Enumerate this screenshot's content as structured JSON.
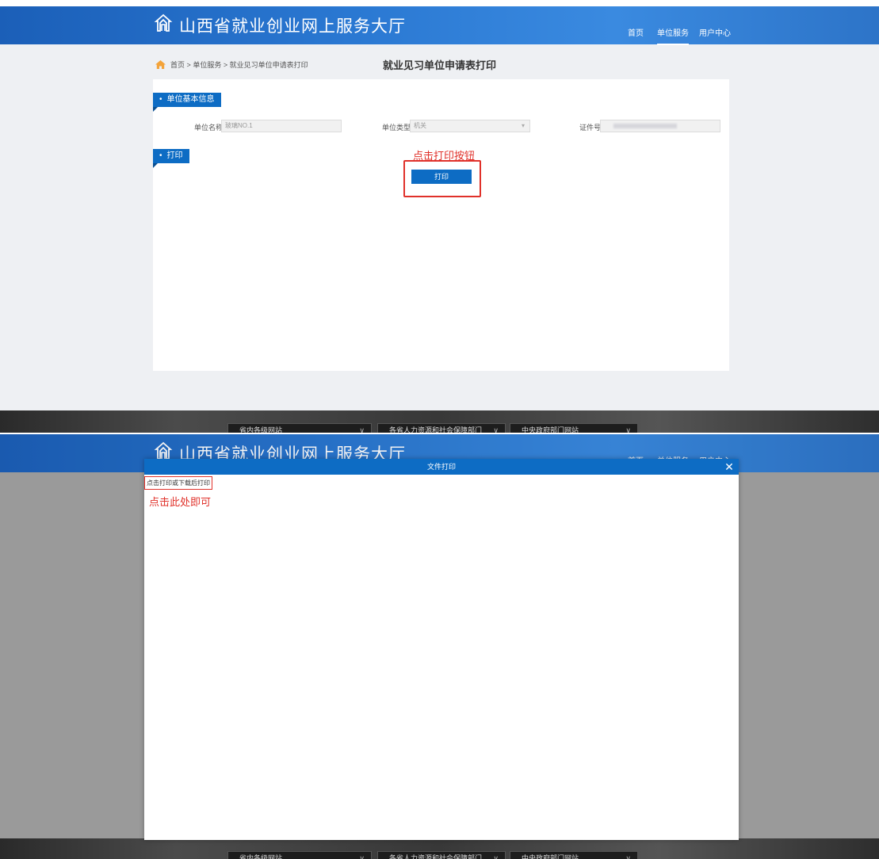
{
  "header": {
    "site_title": "山西省就业创业网上服务大厅",
    "nav": [
      "首页",
      "单位服务",
      "用户中心"
    ],
    "active_nav": "单位服务"
  },
  "breadcrumb": {
    "home": "首页",
    "sep": ">",
    "level2": "单位服务",
    "level3": "就业见习单位申请表打印",
    "full": "首页 > 单位服务 > 就业见习单位申请表打印"
  },
  "page_title": "就业见习单位申请表打印",
  "section_basic": {
    "title": "单位基本信息",
    "fields": {
      "unit_name_label": "单位名称",
      "unit_name_value": "玻璃NO.1",
      "unit_type_label": "单位类型",
      "unit_type_value": "机关",
      "cert_label": "证件号"
    }
  },
  "section_print": {
    "title": "打印",
    "hint": "点击打印按钮",
    "button_label": "打印"
  },
  "footer": {
    "selects": [
      "省内各级网站",
      "各省人力资源和社会保障部门",
      "中央政府部门网站"
    ]
  },
  "modal": {
    "title": "文件打印",
    "close_label": "✕",
    "link_text": "点击打印或下载后打印",
    "hint": "点击此处即可"
  },
  "colors": {
    "primary": "#0d6cc4",
    "annotation_red": "#e0312a",
    "header_blue": "#2a78d2"
  }
}
